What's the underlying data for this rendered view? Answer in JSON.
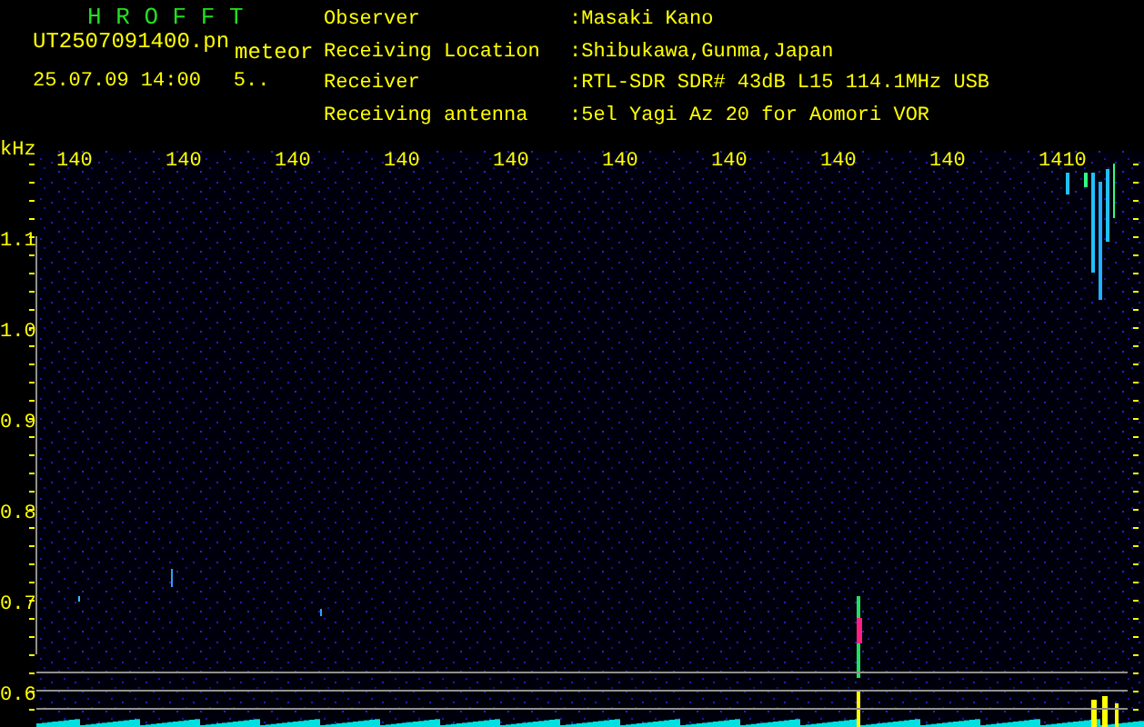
{
  "header": {
    "title": "H R O F F T",
    "filename": "UT2507091400.pn",
    "mode": "meteor",
    "datetime": "25.07.09 14:00",
    "count": "5.."
  },
  "info": [
    {
      "label": "Observer",
      "value": ":Masaki Kano"
    },
    {
      "label": "Receiving Location",
      "value": ":Shibukawa,Gunma,Japan"
    },
    {
      "label": "Receiver",
      "value": ":RTL-SDR SDR# 43dB L15 114.1MHz USB"
    },
    {
      "label": "Receiving antenna",
      "value": ":5el Yagi Az 20 for Aomori VOR"
    }
  ],
  "plot": {
    "unit": "kHz",
    "x_labels": [
      "140",
      "140",
      "140",
      "140",
      "140",
      "140",
      "140",
      "140",
      "140",
      "1410"
    ],
    "y_labels": [
      "1.1",
      "1.0",
      "0.9",
      "0.8",
      "0.7",
      "0.6"
    ]
  }
}
